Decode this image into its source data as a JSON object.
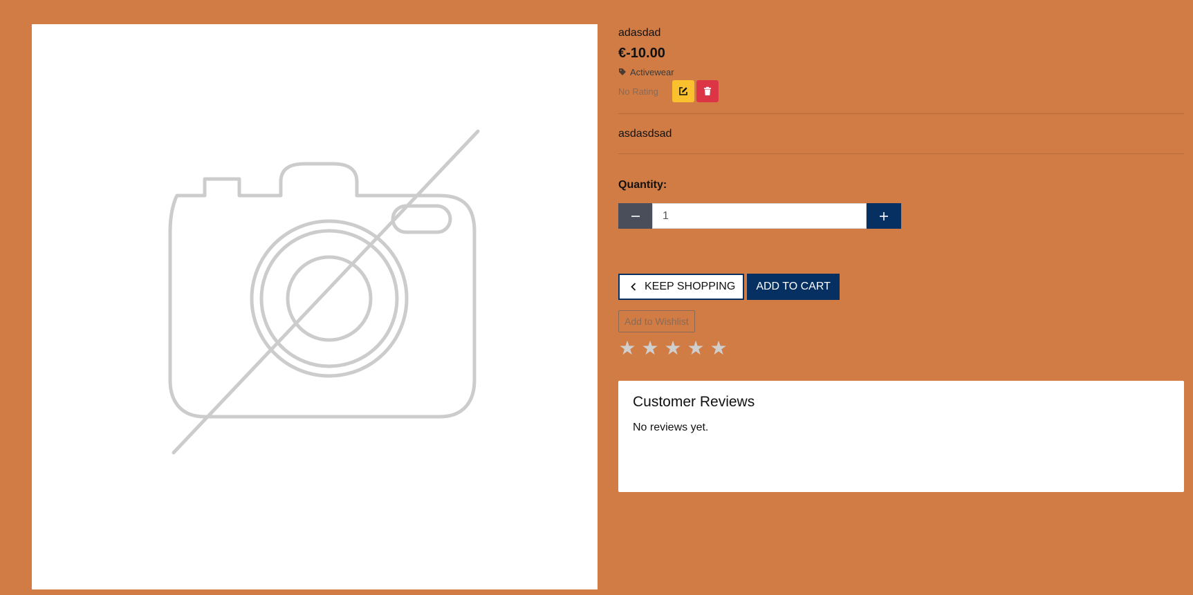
{
  "product": {
    "name": "adasdad",
    "price": "€-10.00",
    "category": "Activewear",
    "rating_text": "No Rating",
    "description": "asdasdsad"
  },
  "image": {
    "icon": "camera-off-icon"
  },
  "admin": {
    "edit_icon": "edit-icon",
    "delete_icon": "trash-icon"
  },
  "quantity": {
    "label": "Quantity:",
    "value": "1"
  },
  "actions": {
    "keep_shopping": "KEEP SHOPPING",
    "add_to_cart": "ADD TO CART",
    "add_to_wishlist": "Add to Wishlist"
  },
  "rating_input": {
    "max_stars": 5,
    "selected": 0,
    "star_glyph": "★"
  },
  "reviews": {
    "title": "Customer Reviews",
    "empty_text": "No reviews yet."
  },
  "colors": {
    "background": "#d17c44",
    "primary": "#053061",
    "edit": "#fbc02d",
    "delete": "#dc3545",
    "minus": "#4a4e5a",
    "star_empty": "#cfcfcf"
  }
}
